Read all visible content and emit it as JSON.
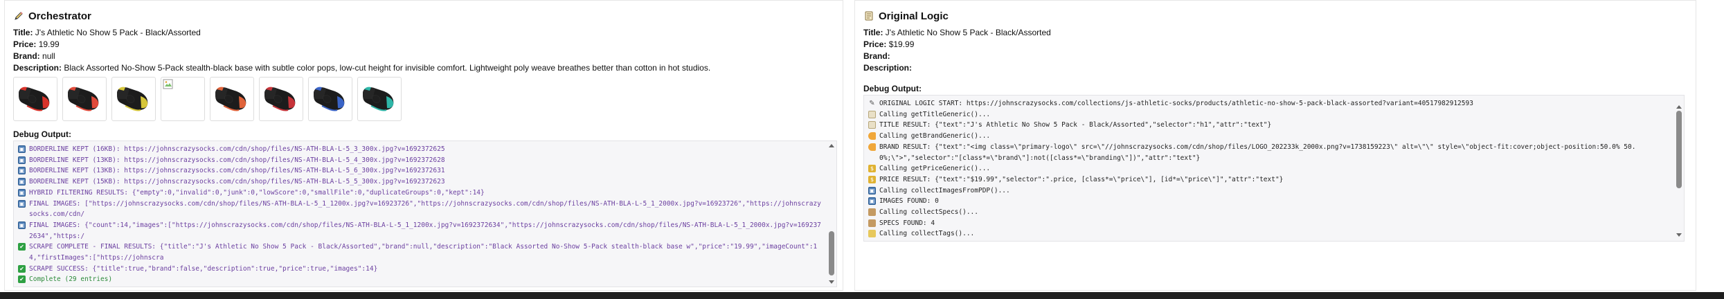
{
  "orchestrator": {
    "title": "Orchestrator",
    "fields": [
      {
        "label": "Title:",
        "value": "J's Athletic No Show 5 Pack - Black/Assorted"
      },
      {
        "label": "Price:",
        "value": "19.99"
      },
      {
        "label": "Brand:",
        "value": "null"
      },
      {
        "label": "Description:",
        "value": "Black Assorted No-Show 5-Pack stealth-black base with subtle color pops, low-cut height for invisible comfort. Lightweight poly weave breathes better than cotton in hot studios."
      }
    ],
    "thumbnails": [
      {
        "accent": "#d8332a",
        "alt": ""
      },
      {
        "accent": "#e04a3a",
        "alt": ""
      },
      {
        "accent": "#d6c63a",
        "alt": ""
      },
      {
        "accent": "",
        "alt": "broken-image"
      },
      {
        "accent": "#e0633a",
        "alt": ""
      },
      {
        "accent": "#c7343a",
        "alt": ""
      },
      {
        "accent": "#3a64c7",
        "alt": ""
      },
      {
        "accent": "#2fb6a8",
        "alt": ""
      }
    ],
    "debug_label": "Debug Output:",
    "log": [
      {
        "icon": "img",
        "tone": "purple",
        "text": "BORDERLINE KEPT (16KB): https://johnscrazysocks.com/cdn/shop/files/NS-ATH-BLA-L-5_3_300x.jpg?v=1692372625"
      },
      {
        "icon": "img",
        "tone": "purple",
        "text": "BORDERLINE KEPT (13KB): https://johnscrazysocks.com/cdn/shop/files/NS-ATH-BLA-L-5_4_300x.jpg?v=1692372628"
      },
      {
        "icon": "img",
        "tone": "purple",
        "text": "BORDERLINE KEPT (13KB): https://johnscrazysocks.com/cdn/shop/files/NS-ATH-BLA-L-5_6_300x.jpg?v=1692372631"
      },
      {
        "icon": "img",
        "tone": "purple",
        "text": "BORDERLINE KEPT (15KB): https://johnscrazysocks.com/cdn/shop/files/NS-ATH-BLA-L-5_5_300x.jpg?v=1692372623"
      },
      {
        "icon": "img",
        "tone": "purple",
        "text": "HYBRID FILTERING RESULTS: {\"empty\":0,\"invalid\":0,\"junk\":0,\"lowScore\":0,\"smallFile\":0,\"duplicateGroups\":0,\"kept\":14}"
      },
      {
        "icon": "img",
        "tone": "purple",
        "text": "FINAL IMAGES: [\"https://johnscrazysocks.com/cdn/shop/files/NS-ATH-BLA-L-5_1_1200x.jpg?v=16923726\",\"https://johnscrazysocks.com/cdn/shop/files/NS-ATH-BLA-L-5_1_2000x.jpg?v=16923726\",\"https://johnscrazysocks.com/cdn/"
      },
      {
        "icon": "img",
        "tone": "purple",
        "text": "FINAL IMAGES: {\"count\":14,\"images\":[\"https://johnscrazysocks.com/cdn/shop/files/NS-ATH-BLA-L-5_1_1200x.jpg?v=1692372634\",\"https://johnscrazysocks.com/cdn/shop/files/NS-ATH-BLA-L-5_1_2000x.jpg?v=1692372634\",\"https:/"
      },
      {
        "icon": "check",
        "tone": "purple",
        "text": "SCRAPE COMPLETE - FINAL RESULTS: {\"title\":\"J's Athletic No Show 5 Pack - Black/Assorted\",\"brand\":null,\"description\":\"Black Assorted No-Show 5-Pack stealth-black base w\",\"price\":\"19.99\",\"imageCount\":14,\"firstImages\":[\"https://johnscra"
      },
      {
        "icon": "check",
        "tone": "purple",
        "text": "SCRAPE SUCCESS: {\"title\":true,\"brand\":false,\"description\":true,\"price\":true,\"images\":14}"
      },
      {
        "icon": "check",
        "tone": "green",
        "text": "Complete (29 entries)"
      }
    ]
  },
  "original": {
    "title": "Original Logic",
    "fields": [
      {
        "label": "Title:",
        "value": "J's Athletic No Show 5 Pack - Black/Assorted"
      },
      {
        "label": "Price:",
        "value": "$19.99"
      },
      {
        "label": "Brand:",
        "value": ""
      },
      {
        "label": "Description:",
        "value": ""
      }
    ],
    "debug_label": "Debug Output:",
    "log": [
      {
        "icon": "pencil",
        "tone": "",
        "text": "ORIGINAL LOGIC START: https://johnscrazysocks.com/collections/js-athletic-socks/products/athletic-no-show-5-pack-black-assorted?variant=40517982912593"
      },
      {
        "icon": "doc",
        "tone": "",
        "text": "Calling getTitleGeneric()..."
      },
      {
        "icon": "doc",
        "tone": "",
        "text": "TITLE RESULT: {\"text\":\"J's Athletic No Show 5 Pack - Black/Assorted\",\"selector\":\"h1\",\"attr\":\"text\"}"
      },
      {
        "icon": "tag",
        "tone": "",
        "text": "Calling getBrandGeneric()..."
      },
      {
        "icon": "tag",
        "tone": "",
        "text": "BRAND RESULT: {\"text\":\"<img class=\\\"primary-logo\\\" src=\\\"//johnscrazysocks.com/cdn/shop/files/LOGO_202233k_2000x.png?v=1738159223\\\" alt=\\\"\\\" style=\\\"object-fit:cover;object-position:50.0% 50.0%;\\\">\",\"selector\":\"[class*=\\\"brand\\\"]:not([class*=\\\"branding\\\"])\",\"attr\":\"text\"}"
      },
      {
        "icon": "money",
        "tone": "",
        "text": "Calling getPriceGeneric()..."
      },
      {
        "icon": "money",
        "tone": "",
        "text": "PRICE RESULT: {\"text\":\"$19.99\",\"selector\":\".price, [class*=\\\"price\\\"], [id*=\\\"price\\\"]\",\"attr\":\"text\"}"
      },
      {
        "icon": "img",
        "tone": "",
        "text": "Calling collectImagesFromPDP()..."
      },
      {
        "icon": "img",
        "tone": "",
        "text": "IMAGES FOUND: 0"
      },
      {
        "icon": "box",
        "tone": "",
        "text": "Calling collectSpecs()..."
      },
      {
        "icon": "box",
        "tone": "",
        "text": "SPECS FOUND: 4"
      },
      {
        "icon": "ruler",
        "tone": "",
        "text": "Calling collectTags()..."
      }
    ]
  }
}
